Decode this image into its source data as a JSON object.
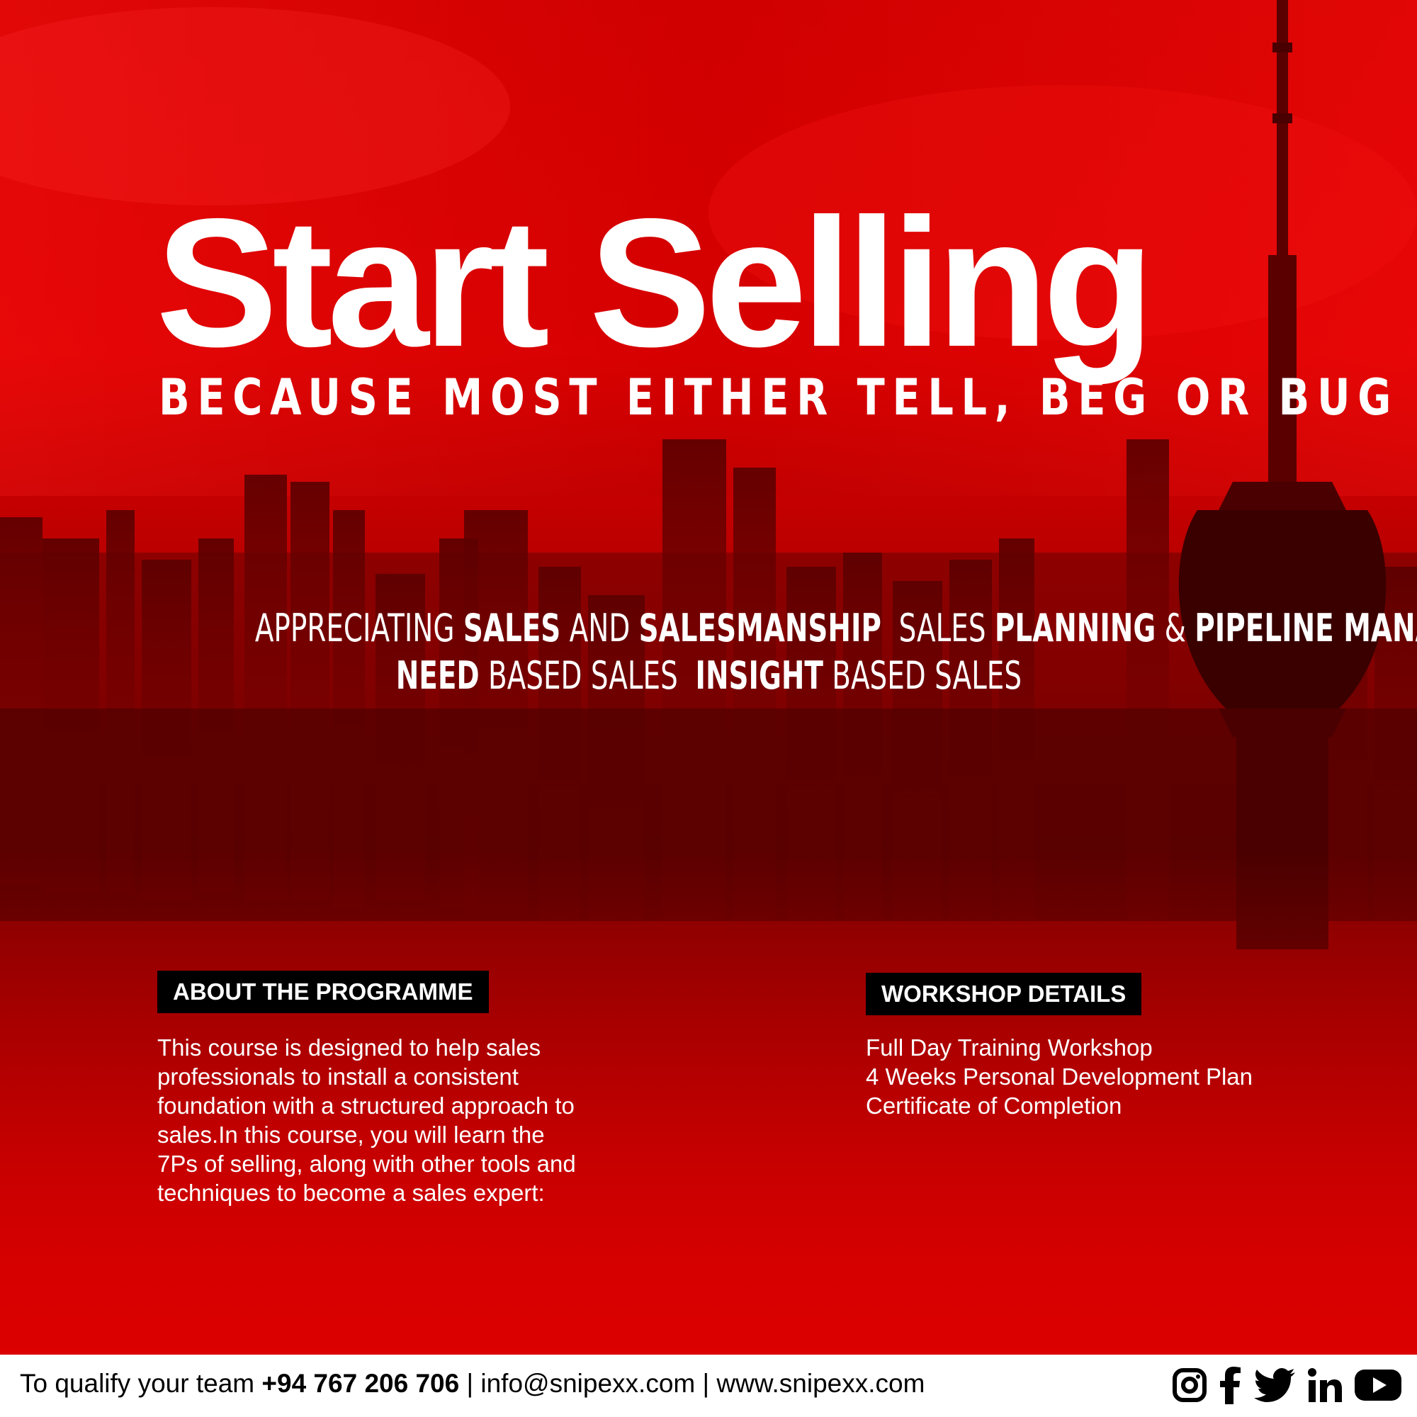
{
  "colors": {
    "accent": "#e00000",
    "text": "#ffffff",
    "heading_bg": "#000000",
    "footer_bg": "#ffffff"
  },
  "hero": {
    "title": "Start Selling",
    "subtitle": "BECAUSE MOST EITHER TELL, BEG OR BUG"
  },
  "topics": {
    "line1": [
      {
        "text": "APPRECIATING ",
        "bold": false
      },
      {
        "text": "SALES",
        "bold": true
      },
      {
        "text": " AND ",
        "bold": false
      },
      {
        "text": "SALESMANSHIP",
        "bold": true
      },
      {
        "text": "  SALES ",
        "bold": false
      },
      {
        "text": "PLANNING",
        "bold": true
      },
      {
        "text": " & ",
        "bold": false
      },
      {
        "text": "PIPELINE MANAGEMENT",
        "bold": true
      }
    ],
    "line2": [
      {
        "text": "NEED",
        "bold": true
      },
      {
        "text": " BASED SALES  ",
        "bold": false
      },
      {
        "text": "INSIGHT",
        "bold": true
      },
      {
        "text": " BASED SALES",
        "bold": false
      }
    ]
  },
  "about": {
    "heading": "ABOUT THE PROGRAMME",
    "body": "This course is designed to help sales professionals to install a consistent foundation with a structured approach to sales.In this course, you will learn the 7Ps of selling, along with other tools and techniques to become a sales expert:"
  },
  "workshop": {
    "heading": "WORKSHOP DETAILS",
    "items": [
      "Full Day Training Workshop",
      "4 Weeks Personal Development Plan",
      "Certificate of Completion"
    ]
  },
  "footer": {
    "prefix": "To qualify your team ",
    "phone": "+94 767 206 706",
    "separator1": " | ",
    "email": "info@snipexx.com",
    "separator2": " | ",
    "website": "www.snipexx.com",
    "social_icons": [
      "instagram-icon",
      "facebook-icon",
      "twitter-icon",
      "linkedin-icon",
      "youtube-icon"
    ]
  }
}
